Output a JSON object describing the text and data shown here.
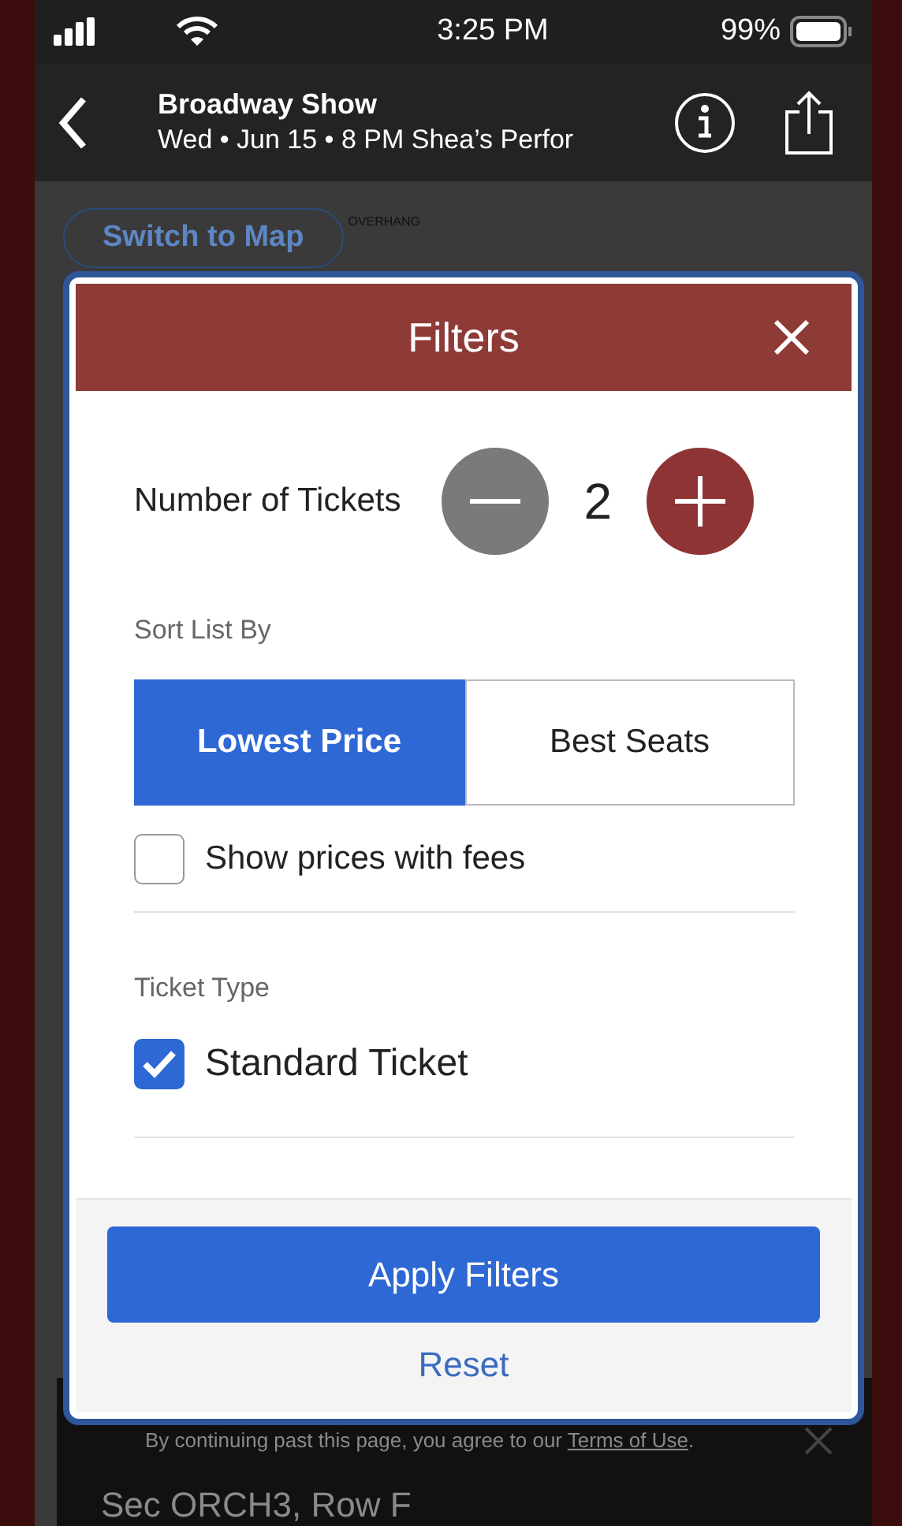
{
  "status_bar": {
    "time": "3:25 PM",
    "battery": "99%"
  },
  "header": {
    "title": "Broadway Show",
    "subtitle": "Wed • Jun 15 • 8 PM Shea’s Perfor"
  },
  "map": {
    "switch_button": "Switch to Map",
    "labels": [
      "OVERHANG"
    ]
  },
  "filters": {
    "title": "Filters",
    "tickets": {
      "label": "Number of Tickets",
      "count": "2",
      "steppers": [
        {
          "kind": "minus",
          "disabled": true
        },
        {
          "kind": "plus",
          "disabled": false
        }
      ]
    },
    "sort": {
      "label": "Sort List By",
      "options": [
        {
          "label": "Lowest Price",
          "selected": true
        },
        {
          "label": "Best Seats",
          "selected": false
        }
      ]
    },
    "show_fees": {
      "label": "Show prices with fees",
      "checked": false
    },
    "ticket_type": {
      "label": "Ticket Type",
      "options": [
        {
          "label": "Standard Ticket",
          "checked": true
        }
      ]
    },
    "apply_button": "Apply Filters",
    "reset_link": "Reset"
  },
  "notice": {
    "text_before": "By continuing past this page, you agree to our ",
    "link": "Terms of Use",
    "text_after": "."
  },
  "listing": {
    "section": "Sec ORCH3, Row F"
  }
}
